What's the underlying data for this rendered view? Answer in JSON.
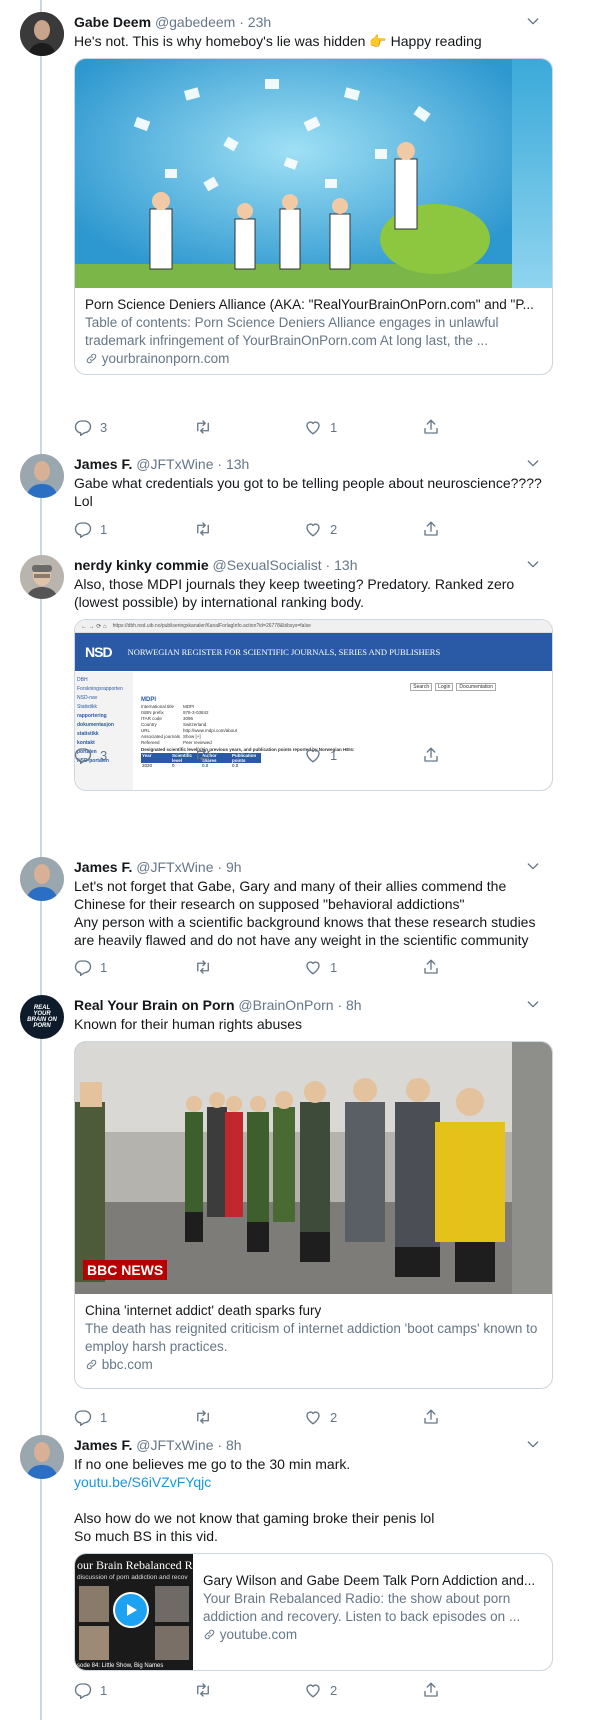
{
  "tweets": [
    {
      "name": "Gabe Deem",
      "handle": "@gabedeem",
      "time": "23h",
      "text": "He's not. This is why homeboy's lie was hidden 👉 Happy reading",
      "card": {
        "title": "Porn Science Deniers Alliance (AKA: \"RealYourBrainOnPorn.com\" and \"P...",
        "description": "Table of contents: Porn Science Deniers Alliance engages in unlawful trademark infringement of YourBrainOnPorn.com At long last, the ...",
        "domain": "yourbrainonporn.com"
      },
      "replies": "3",
      "retweets": "",
      "likes": "1"
    },
    {
      "name": "James F.",
      "handle": "@JFTxWine",
      "time": "13h",
      "text": "Gabe what credentials you got to be telling people about neuroscience???? Lol",
      "replies": "1",
      "retweets": "",
      "likes": "2"
    },
    {
      "name": "nerdy kinky commie",
      "handle": "@SexualSocialist",
      "time": "13h",
      "text": "Also, those MDPI journals they keep tweeting? Predatory. Ranked zero (lowest possible) by international ranking body.",
      "screenshot": {
        "url": "https://dbh.nsd.uib.no/publiseringskanaler/KanalForlagInfo.action?id=26778&bibsys=false",
        "banner": "NORWEGIAN REGISTER FOR SCIENTIFIC JOURNALS, SERIES AND PUBLISHERS",
        "logo": "NSD",
        "search": "Search",
        "login": "Login",
        "documentation": "Documentation",
        "side_items": [
          "DBH",
          "Forskningsrapporten",
          "NSD-nav",
          "Statistikk",
          "rapportering",
          "dokumentasjon",
          "statistikk",
          "kontakt",
          "portalen",
          "NSD-portalen"
        ],
        "publisher": "MDPI",
        "fields": [
          [
            "International title",
            "MDPI"
          ],
          [
            "ISBN prefix",
            "978-3-03842"
          ],
          [
            "ITAR code",
            "3096"
          ],
          [
            "Country",
            "Switzerland"
          ],
          [
            "URL",
            "http://www.mdpi.com/about"
          ],
          [
            "Associated journals",
            "Show [+]"
          ],
          [
            "Refereed",
            "Peer reviewed"
          ]
        ],
        "table_caption": "Designated scientific level(s) in previous years, and publication points reported by Norwegian HEIs:",
        "table_headers": [
          "Year",
          "Scientific level",
          "Author shares",
          "Publication points"
        ],
        "table_row": [
          "2020",
          "0",
          "0.0",
          "0.0"
        ]
      },
      "replies": "3",
      "retweets": "",
      "likes": "1"
    },
    {
      "name": "James F.",
      "handle": "@JFTxWine",
      "time": "9h",
      "text_lines": [
        "Let's not forget that Gabe, Gary and many of their allies commend the Chinese for their research on supposed \"behavioral addictions\"",
        "Any person with a scientific background knows that these research studies are heavily flawed and do not have any weight in the scientific community"
      ],
      "replies": "1",
      "retweets": "",
      "likes": "1"
    },
    {
      "name": "Real Your Brain on Porn",
      "handle": "@BrainOnPorn",
      "time": "8h",
      "avatar_text": "REAL YOUR BRAIN ON PORN",
      "text": "Known for their human rights abuses",
      "card": {
        "badge": "BBC NEWS",
        "title": "China 'internet addict' death sparks fury",
        "description": "The death has reignited criticism of internet addiction 'boot camps' known to employ harsh practices.",
        "domain": "bbc.com"
      },
      "replies": "1",
      "retweets": "",
      "likes": "2"
    },
    {
      "name": "James F.",
      "handle": "@JFTxWine",
      "time": "8h",
      "text_line1": "If no one believes me go to the 30 min mark.",
      "link": "youtu.be/S6iVZvFYqjc",
      "text_line3": "Also how do we not know that gaming broke their penis lol",
      "text_line4": "So much BS in this vid.",
      "card": {
        "thumb_title": "our Brain Rebalanced Radi",
        "thumb_sub": "discussion of porn addiction and recov",
        "thumb_bottom": "sode 84: Little Show, Big Names",
        "title": "Gary Wilson and Gabe Deem Talk Porn Addiction and...",
        "description": "Your Brain Rebalanced Radio: the show about porn addiction and recovery. Listen to back episodes on ...",
        "domain": "youtube.com"
      },
      "replies": "1",
      "retweets": "",
      "likes": "2"
    }
  ],
  "icons": [
    "reply-icon",
    "retweet-icon",
    "like-icon",
    "share-icon",
    "caret-icon",
    "link-icon",
    "play-icon"
  ],
  "colors": {
    "link": "#1b95e0",
    "secondary": "#657786",
    "border": "#ccd6dd",
    "nsd_blue": "#2a5aa6"
  }
}
